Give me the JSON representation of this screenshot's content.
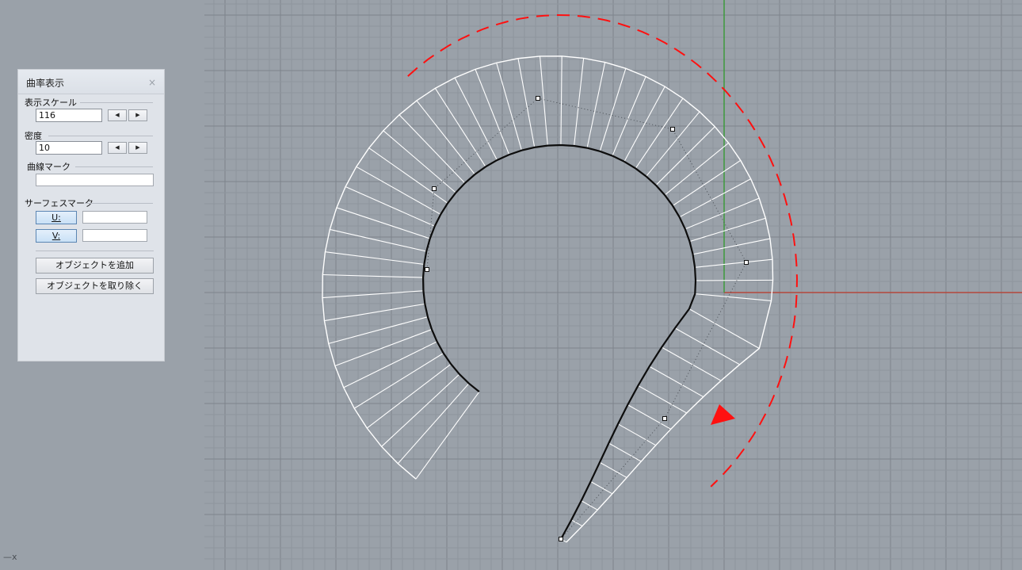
{
  "viewport": {
    "axis_indicator": "—x"
  },
  "panel": {
    "title": "曲率表示",
    "close_icon": "×",
    "scale_section_label": "表示スケール",
    "scale_value": "116",
    "density_section_label": "密度",
    "density_value": "10",
    "spin_left": "◀",
    "spin_right": "▶",
    "curve_mark_label": "曲線マーク",
    "surface_mark_label": "サーフェスマーク",
    "u_button": "U:",
    "v_button": "V:",
    "add_object_button": "オブジェクトを追加",
    "remove_object_button": "オブジェクトを取り除く"
  },
  "colors": {
    "background": "#9aa1a9",
    "grid_minor": "#8e959d",
    "grid_major": "#7d848c",
    "x_axis": "#b3483c",
    "y_axis": "#3c9a3c",
    "curve": "#0d0d0d",
    "comb": "#ffffff",
    "arrow": "#ff1010"
  }
}
